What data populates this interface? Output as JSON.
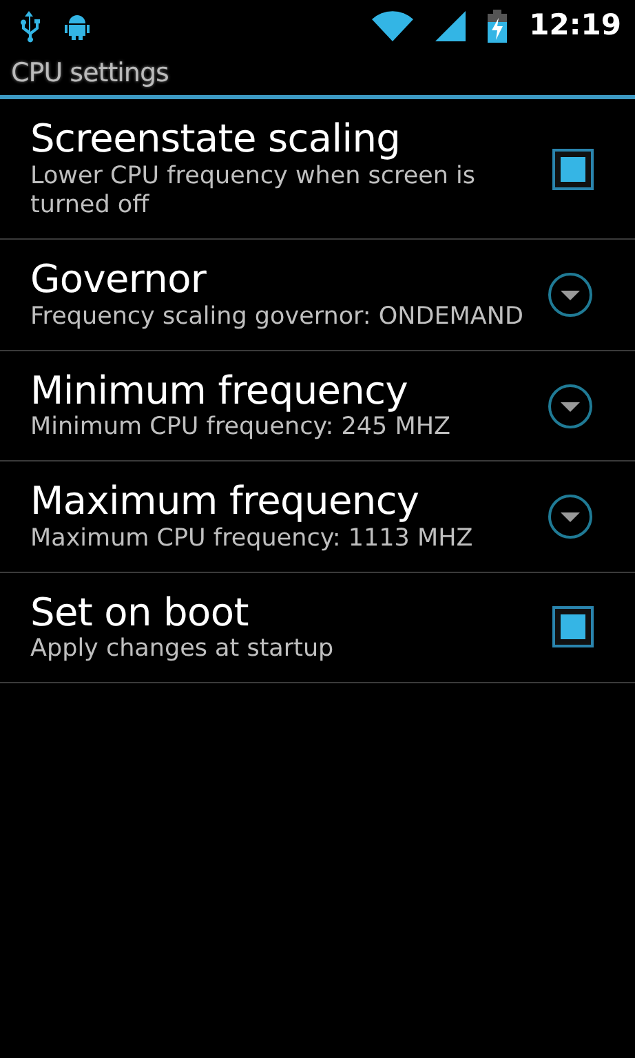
{
  "status_bar": {
    "time": "12:19"
  },
  "title": "CPU settings",
  "preferences": [
    {
      "kind": "checkbox",
      "title": "Screenstate scaling",
      "summary": "Lower CPU frequency when screen is turned off",
      "checked": true
    },
    {
      "kind": "list",
      "title": "Governor",
      "summary": "Frequency scaling governor: ONDEMAND"
    },
    {
      "kind": "list",
      "title": "Minimum frequency",
      "summary": "Minimum CPU frequency: 245 MHZ"
    },
    {
      "kind": "list",
      "title": "Maximum frequency",
      "summary": "Maximum CPU frequency: 1113 MHZ"
    },
    {
      "kind": "checkbox",
      "title": "Set on boot",
      "summary": "Apply changes at startup",
      "checked": true
    }
  ]
}
